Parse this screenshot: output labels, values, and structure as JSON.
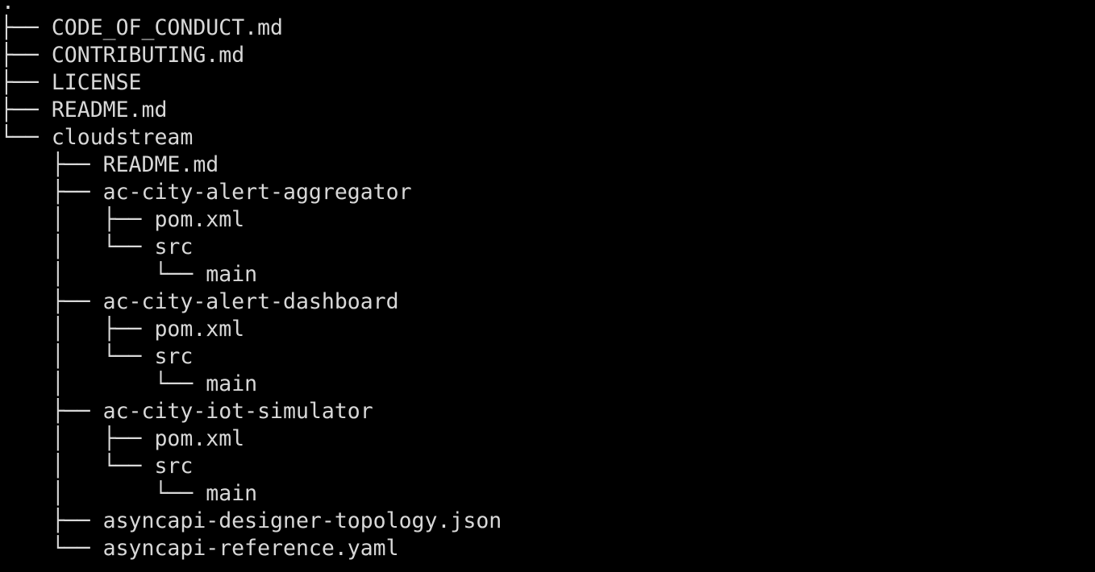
{
  "terminal": {
    "root": ".",
    "lines": [
      {
        "prefix": "├── ",
        "name": "CODE_OF_CONDUCT.md"
      },
      {
        "prefix": "├── ",
        "name": "CONTRIBUTING.md"
      },
      {
        "prefix": "├── ",
        "name": "LICENSE"
      },
      {
        "prefix": "├── ",
        "name": "README.md"
      },
      {
        "prefix": "└── ",
        "name": "cloudstream"
      },
      {
        "prefix": "    ├── ",
        "name": "README.md"
      },
      {
        "prefix": "    ├── ",
        "name": "ac-city-alert-aggregator"
      },
      {
        "prefix": "    │   ├── ",
        "name": "pom.xml"
      },
      {
        "prefix": "    │   └── ",
        "name": "src"
      },
      {
        "prefix": "    │       └── ",
        "name": "main"
      },
      {
        "prefix": "    ├── ",
        "name": "ac-city-alert-dashboard"
      },
      {
        "prefix": "    │   ├── ",
        "name": "pom.xml"
      },
      {
        "prefix": "    │   └── ",
        "name": "src"
      },
      {
        "prefix": "    │       └── ",
        "name": "main"
      },
      {
        "prefix": "    ├── ",
        "name": "ac-city-iot-simulator"
      },
      {
        "prefix": "    │   ├── ",
        "name": "pom.xml"
      },
      {
        "prefix": "    │   └── ",
        "name": "src"
      },
      {
        "prefix": "    │       └── ",
        "name": "main"
      },
      {
        "prefix": "    ├── ",
        "name": "asyncapi-designer-topology.json"
      },
      {
        "prefix": "    └── ",
        "name": "asyncapi-reference.yaml"
      }
    ]
  },
  "colors": {
    "background": "#000000",
    "text": "#d8d8d8"
  }
}
